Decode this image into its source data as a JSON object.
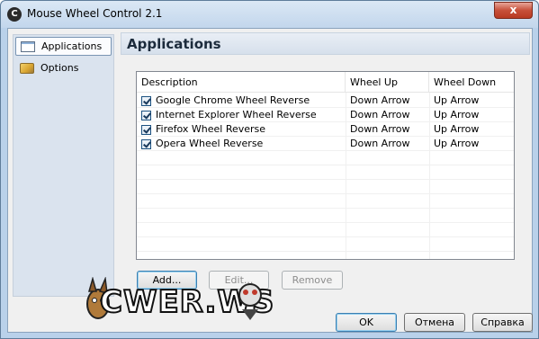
{
  "window": {
    "title": "Mouse Wheel Control 2.1",
    "app_icon": "mouse-wheel-app-icon",
    "close_label": "x"
  },
  "sidebar": {
    "items": [
      {
        "label": "Applications",
        "icon": "window-icon",
        "selected": true
      },
      {
        "label": "Options",
        "icon": "options-icon",
        "selected": false
      }
    ]
  },
  "main": {
    "title": "Applications",
    "table": {
      "headers": [
        "Description",
        "Wheel Up",
        "Wheel Down"
      ],
      "rows": [
        {
          "checked": true,
          "description": "Google Chrome Wheel Reverse",
          "wheel_up": "Down Arrow",
          "wheel_down": "Up Arrow"
        },
        {
          "checked": true,
          "description": "Internet Explorer Wheel Reverse",
          "wheel_up": "Down Arrow",
          "wheel_down": "Up Arrow"
        },
        {
          "checked": true,
          "description": "Firefox Wheel Reverse",
          "wheel_up": "Down Arrow",
          "wheel_down": "Up Arrow"
        },
        {
          "checked": true,
          "description": "Opera Wheel Reverse",
          "wheel_up": "Down Arrow",
          "wheel_down": "Up Arrow"
        }
      ]
    },
    "buttons": {
      "add": "Add...",
      "edit": "Edit...",
      "remove": "Remove"
    }
  },
  "footer": {
    "ok": "OK",
    "cancel": "Отмена",
    "help": "Справка"
  },
  "watermark": {
    "text": "CWER.WS"
  },
  "colors": {
    "frame": "#b9d1ea",
    "accent": "#3c7fb1"
  }
}
